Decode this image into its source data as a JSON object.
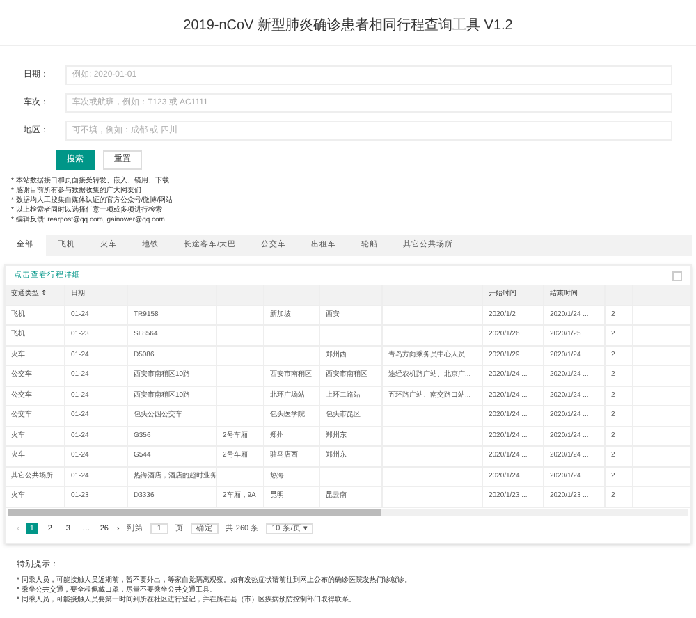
{
  "title": "2019-nCoV 新型肺炎确诊患者相同行程查询工具 V1.2",
  "form": {
    "fields": [
      {
        "label": "日期：",
        "placeholder": "例如: 2020-01-01"
      },
      {
        "label": "车次：",
        "placeholder": "车次或航班，例如：T123 或 AC1111"
      },
      {
        "label": "地区：",
        "placeholder": "可不填，例如：成都 或 四川"
      }
    ],
    "buttons": [
      {
        "label": "搜索",
        "kind": "primary"
      },
      {
        "label": "重置",
        "kind": "default"
      }
    ]
  },
  "notes": [
    "* 本站数据接口和页面接受转发、嵌入、镜用、下载",
    "* 感谢目前所有参与数据收集的广大网友们",
    "* 数据均人工搜集自媒体认证的官方公众号/微博/网站",
    "* 以上检索者同时以选择任意一项或多项进行检索",
    "* 编辑反馈: rearpost@qq.com, gainower@qq.com"
  ],
  "tabs": [
    {
      "label": "全部",
      "selected": true
    },
    {
      "label": "飞机",
      "selected": false
    },
    {
      "label": "火车",
      "selected": false
    },
    {
      "label": "地铁",
      "selected": false
    },
    {
      "label": "长途客车/大巴",
      "selected": false
    },
    {
      "label": "公交车",
      "selected": false
    },
    {
      "label": "出租车",
      "selected": false
    },
    {
      "label": "轮船",
      "selected": false
    },
    {
      "label": "其它公共场所",
      "selected": false
    }
  ],
  "table": {
    "caption": "点击查看行程详细",
    "columns": [
      "交通类型 ⇕",
      "日期",
      "",
      "",
      "",
      "",
      "",
      "开始时间",
      "结束时间",
      ""
    ],
    "rows": [
      [
        "飞机",
        "01-24",
        "TR9158",
        "",
        "新加坡",
        "西安",
        "",
        "2020/1/2",
        "2020/1/24 ...",
        "2"
      ],
      [
        "飞机",
        "01-23",
        "SL8564",
        "",
        "",
        "",
        "",
        "2020/1/26",
        "2020/1/25 ...",
        "2"
      ],
      [
        "火车",
        "01-24",
        "D5086",
        "",
        "",
        "郑州西",
        "青岛方向乘务员中心人员 ...",
        "2020/1/29",
        "2020/1/24 ...",
        "2"
      ],
      [
        "公交车",
        "01-24",
        "西安市南稍区10路",
        "",
        "西安市南稍区",
        "西安市南稍区",
        "途经农机路广站、北京广...",
        "2020/1/24 ...",
        "2020/1/24 ...",
        "2"
      ],
      [
        "公交车",
        "01-24",
        "西安市南稍区10路",
        "",
        "北环广场站",
        "上环二路站",
        "五环路广站、南交路口站...",
        "2020/1/24 ...",
        "2020/1/24 ...",
        "2"
      ],
      [
        "公交车",
        "01-24",
        "包头公园公交车",
        "",
        "包头医学院",
        "包头市昆区",
        "",
        "2020/1/24 ...",
        "2020/1/24 ...",
        "2"
      ],
      [
        "火车",
        "01-24",
        "G356",
        "2号车厢",
        "郑州",
        "郑州东",
        "",
        "2020/1/24 ...",
        "2020/1/24 ...",
        "2"
      ],
      [
        "火车",
        "01-24",
        "G544",
        "2号车厢",
        "驻马店西",
        "郑州东",
        "",
        "2020/1/24 ...",
        "2020/1/24 ...",
        "2"
      ],
      [
        "其它公共场所",
        "01-24",
        "热海酒店，酒店的超时业务",
        "",
        "热海...",
        "",
        "",
        "2020/1/24 ...",
        "2020/1/24 ...",
        "2"
      ],
      [
        "火车",
        "01-23",
        "D3336",
        "2车厢，9A",
        "昆明",
        "昆云南",
        "",
        "2020/1/23 ...",
        "2020/1/23 ...",
        "2"
      ]
    ]
  },
  "pagination": {
    "pages": [
      {
        "label": "1",
        "selected": true
      },
      {
        "label": "2",
        "selected": false
      },
      {
        "label": "3",
        "selected": false
      },
      {
        "label": "…",
        "selected": false
      },
      {
        "label": "26",
        "selected": false
      }
    ],
    "prev": "‹",
    "next": "›",
    "goto_label": "到第",
    "goto_value": "1",
    "page_unit": "页",
    "confirm": "确定",
    "total": "共 260 条",
    "page_size": "10 条/页 ▾"
  },
  "tips": {
    "title": "特别提示：",
    "lines": [
      "* 同乘人员，可能接触人员近期前，暂不要外出，等家自觉隔离观察。如有发热症状请前往到网上公布的确诊医院发热门诊就诊。",
      "* 乘坐公共交通，要全程佩戴口罩，尽量不要乘坐公共交通工具。",
      "* 同乘人员，可能接触人员要第一时间到所在社区进行登记，并在所在县（市）区疾病预防控制部门取得联系。"
    ]
  }
}
